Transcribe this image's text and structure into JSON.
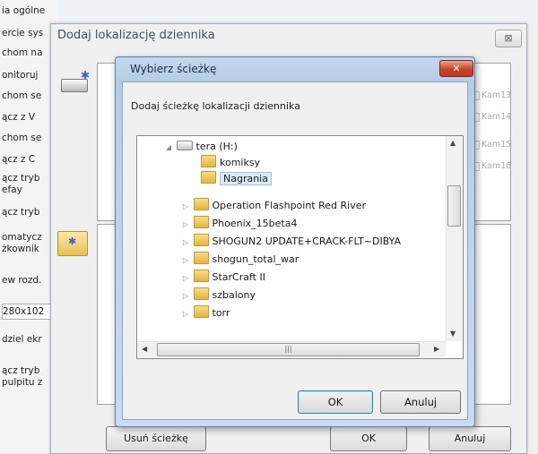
{
  "left_column": {
    "labels": [
      "ia ogólne",
      "ercie sys",
      "chom na",
      "onitoruj",
      "chom se",
      "ącz z V",
      "chom se",
      "ącz z C",
      "ącz tryb",
      "efay",
      "ącz tryb",
      "omatycz",
      "żkownik",
      "ew rozd.",
      "280x102",
      "dziel ekr",
      "ącz tryb",
      "pulpitu z"
    ]
  },
  "outer_dialog": {
    "title": "Dodaj lokalizację dziennika",
    "close_symbol": "⊠",
    "camera_labels": [
      "Kam13",
      "Kam14",
      "Kam15",
      "Kam16"
    ],
    "remove_path_label": "Usuń ścieżkę",
    "ok_label": "OK",
    "cancel_label": "Anuluj"
  },
  "inner_dialog": {
    "title": "Wybierz ścieżkę",
    "close_symbol": "✕",
    "instruction": "Dodaj ścieżkę lokalizacji dziennika",
    "drive": "tera (H:)",
    "folders": [
      "komiksy",
      "Nagrania",
      "Operation Flashpoint Red River",
      "Phoenix_15beta4",
      "SHOGUN2 UPDATE+CRACK-FLT~DIBYA",
      "shogun_total_war",
      "StarCraft II",
      "szbalony",
      "torr"
    ],
    "selected_folder": "Nagrania",
    "ok_label": "OK",
    "cancel_label": "Anuluj",
    "scroll_grip": "|||"
  },
  "icons": {
    "collapse": "◢",
    "expand": "▷",
    "scroll_up": "▲",
    "scroll_down": "▼",
    "scroll_left": "◀",
    "scroll_right": "▶"
  }
}
